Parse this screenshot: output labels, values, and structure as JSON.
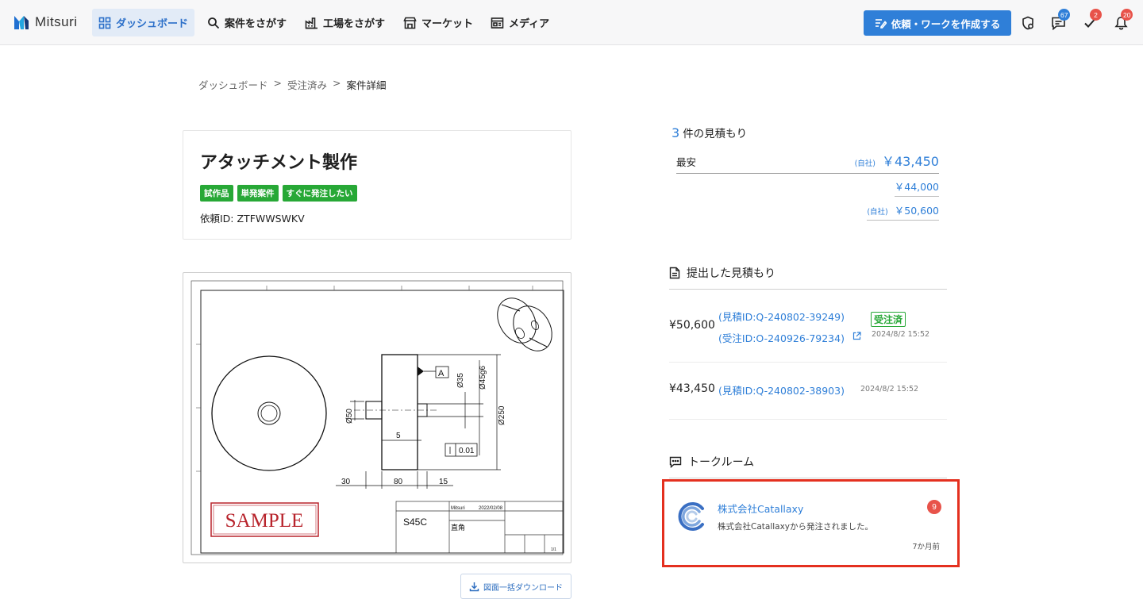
{
  "header": {
    "logo_text": "Mitsuri",
    "nav": [
      {
        "label": "ダッシュボード",
        "icon": "grid-icon",
        "active": true
      },
      {
        "label": "案件をさがす",
        "icon": "search-icon"
      },
      {
        "label": "工場をさがす",
        "icon": "factory-icon"
      },
      {
        "label": "マーケット",
        "icon": "store-icon"
      },
      {
        "label": "メディア",
        "icon": "media-icon"
      }
    ],
    "create_button": "依頼・ワークを作成する",
    "badges": {
      "messages": "67",
      "tasks": "2",
      "notifications": "20"
    }
  },
  "breadcrumb": {
    "items": [
      "ダッシュボード",
      "受注済み",
      "案件詳細"
    ],
    "separator": ">"
  },
  "project": {
    "title": "アタッチメント製作",
    "tags": [
      "試作品",
      "単発案件",
      "すぐに発注したい"
    ],
    "request_id": "依頼ID: ZTFWWSWKV"
  },
  "drawing": {
    "material": "S45C",
    "finish": "直角",
    "stamp": "SAMPLE",
    "tb_created": "Mitsuri",
    "tb_date": "2022/02/08",
    "tb_sheet": "1/1",
    "datum": "A",
    "dim_d35": "Ø35",
    "dim_d45": "Ø45g6",
    "dim_d50": "Ø50",
    "dim_d250": "Ø250",
    "dim_5": "5",
    "dim_001": "0.01",
    "dim_30": "30",
    "dim_80": "80",
    "dim_15": "15",
    "download_label": "図面一括ダウンロード"
  },
  "quotes": {
    "count": "3",
    "heading_suffix": "件の見積もり",
    "cheapest_label": "最安",
    "rows": [
      {
        "own": "(自社)",
        "price": "￥43,450"
      },
      {
        "own": "",
        "price": "￥44,000"
      },
      {
        "own": "(自社)",
        "price": "￥50,600"
      }
    ]
  },
  "submitted": {
    "heading": "提出した見積もり",
    "items": [
      {
        "amount": "¥50,600",
        "quote_id": "(見積ID:Q-240802-39249)",
        "order_id": "(受注ID:O-240926-79234)",
        "status": "受注済",
        "date": "2024/8/2 15:52"
      },
      {
        "amount": "¥43,450",
        "quote_id": "(見積ID:Q-240802-38903)",
        "date": "2024/8/2 15:52"
      }
    ]
  },
  "talkroom": {
    "heading": "トークルーム",
    "company": "株式会社Catallaxy",
    "message": "株式会社Catallaxyから発注されました。",
    "unread": "9",
    "time": "7か月前"
  },
  "colors": {
    "accent": "#2f7fd8",
    "tag_green": "#27a836",
    "badge_red": "#e8534a",
    "highlight": "#e4301f"
  }
}
